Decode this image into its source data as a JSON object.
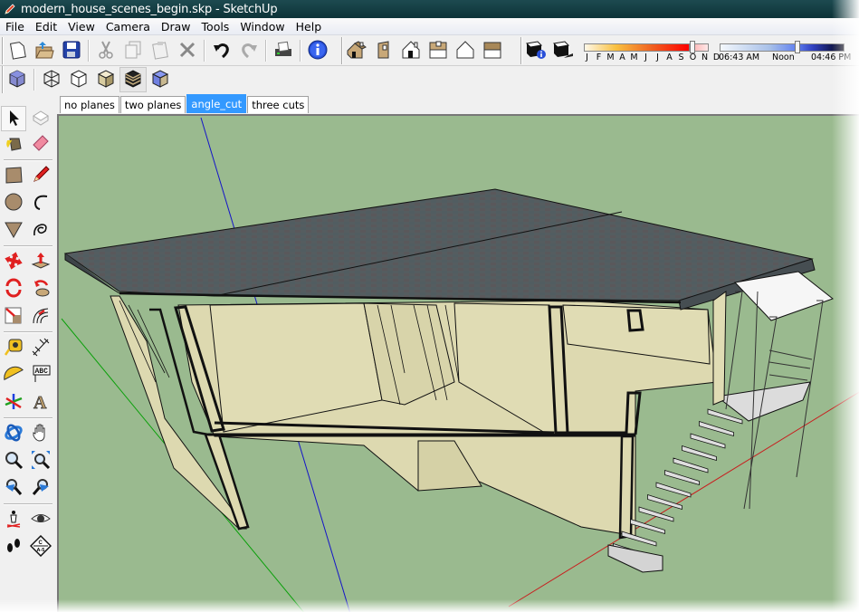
{
  "window": {
    "title": "modern_house_scenes_begin.skp - SketchUp",
    "app_icon": "sketchup-pencil-icon"
  },
  "menu": [
    "File",
    "Edit",
    "View",
    "Camera",
    "Draw",
    "Tools",
    "Window",
    "Help"
  ],
  "toolbar_standard": [
    {
      "name": "new",
      "icon": "new-file-icon"
    },
    {
      "name": "open",
      "icon": "open-folder-icon"
    },
    {
      "name": "save",
      "icon": "save-disk-icon"
    },
    {
      "name": "cut",
      "icon": "scissors-icon"
    },
    {
      "name": "copy",
      "icon": "copy-icon"
    },
    {
      "name": "paste",
      "icon": "paste-icon"
    },
    {
      "name": "erase",
      "icon": "delete-x-icon"
    },
    {
      "name": "undo",
      "icon": "undo-arrow-icon"
    },
    {
      "name": "redo",
      "icon": "redo-arrow-icon"
    },
    {
      "name": "print",
      "icon": "printer-icon"
    },
    {
      "name": "model-info",
      "icon": "info-icon"
    }
  ],
  "toolbar_views": [
    {
      "name": "iso",
      "icon": "iso-house-icon"
    },
    {
      "name": "top",
      "icon": "top-view-icon"
    },
    {
      "name": "front",
      "icon": "front-view-icon"
    },
    {
      "name": "right",
      "icon": "right-view-icon"
    },
    {
      "name": "back",
      "icon": "back-view-icon"
    },
    {
      "name": "left",
      "icon": "left-view-icon"
    }
  ],
  "toolbar_shadows": [
    {
      "name": "shadow-settings",
      "icon": "shadow-settings-icon"
    },
    {
      "name": "display-shadows",
      "icon": "display-shadows-icon"
    }
  ],
  "shadow_sliders": {
    "months": [
      "J",
      "F",
      "M",
      "A",
      "M",
      "J",
      "J",
      "A",
      "S",
      "O",
      "N",
      "D"
    ],
    "date_position": 0.87,
    "time_start": "06:43 AM",
    "time_mid": "Noon",
    "time_end": "04:46 PM",
    "time_position": 0.62
  },
  "toolbar_styles": [
    {
      "name": "xray",
      "icon": "xray-cube-icon"
    },
    {
      "name": "wireframe",
      "icon": "wireframe-cube-icon"
    },
    {
      "name": "hidden-line",
      "icon": "hidden-line-cube-icon"
    },
    {
      "name": "shaded",
      "icon": "shaded-cube-icon"
    },
    {
      "name": "shaded-textures",
      "icon": "textured-cube-icon",
      "selected": true
    },
    {
      "name": "monochrome",
      "icon": "monochrome-cube-icon"
    }
  ],
  "scene_tabs": [
    {
      "label": "no planes",
      "active": false
    },
    {
      "label": "two planes",
      "active": false
    },
    {
      "label": "angle_cut",
      "active": true
    },
    {
      "label": "three cuts",
      "active": false
    }
  ],
  "left_tools": [
    {
      "name": "select",
      "icon": "select-arrow-icon",
      "selected": true
    },
    {
      "name": "make-component",
      "icon": "component-icon"
    },
    {
      "name": "paint-bucket",
      "icon": "paint-bucket-icon"
    },
    {
      "name": "eraser",
      "icon": "eraser-icon"
    },
    {
      "name": "rectangle",
      "icon": "rectangle-icon"
    },
    {
      "name": "line",
      "icon": "pencil-icon"
    },
    {
      "name": "circle",
      "icon": "circle-icon"
    },
    {
      "name": "arc",
      "icon": "arc-icon"
    },
    {
      "name": "polygon",
      "icon": "polygon-icon"
    },
    {
      "name": "freehand",
      "icon": "freehand-icon"
    },
    {
      "name": "move",
      "icon": "move-icon"
    },
    {
      "name": "push-pull",
      "icon": "push-pull-icon"
    },
    {
      "name": "rotate",
      "icon": "rotate-icon"
    },
    {
      "name": "follow-me",
      "icon": "follow-me-icon"
    },
    {
      "name": "scale",
      "icon": "scale-icon"
    },
    {
      "name": "offset",
      "icon": "offset-icon"
    },
    {
      "name": "tape-measure",
      "icon": "tape-measure-icon"
    },
    {
      "name": "dimension",
      "icon": "dimension-icon"
    },
    {
      "name": "protractor",
      "icon": "protractor-icon"
    },
    {
      "name": "text",
      "icon": "text-label-icon",
      "label": "ABC"
    },
    {
      "name": "axes",
      "icon": "axes-icon"
    },
    {
      "name": "3d-text",
      "icon": "3d-text-icon",
      "label": "A"
    },
    {
      "name": "orbit",
      "icon": "orbit-icon"
    },
    {
      "name": "pan",
      "icon": "pan-hand-icon"
    },
    {
      "name": "zoom",
      "icon": "zoom-icon"
    },
    {
      "name": "zoom-window",
      "icon": "zoom-window-icon"
    },
    {
      "name": "previous",
      "icon": "previous-view-icon"
    },
    {
      "name": "next",
      "icon": "next-view-icon"
    },
    {
      "name": "position-camera",
      "icon": "position-camera-icon"
    },
    {
      "name": "look-around",
      "icon": "eye-icon"
    },
    {
      "name": "walk",
      "icon": "footprints-icon"
    },
    {
      "name": "section-plane",
      "icon": "section-plane-icon",
      "label": "C\nA-5"
    }
  ],
  "viewport": {
    "background_color": "#9aba8f",
    "model": "modern house section cut (angle_cut scene)",
    "axis_colors": {
      "red": "#c81e1e",
      "green": "#0aa00a",
      "blue": "#1414c8"
    }
  }
}
